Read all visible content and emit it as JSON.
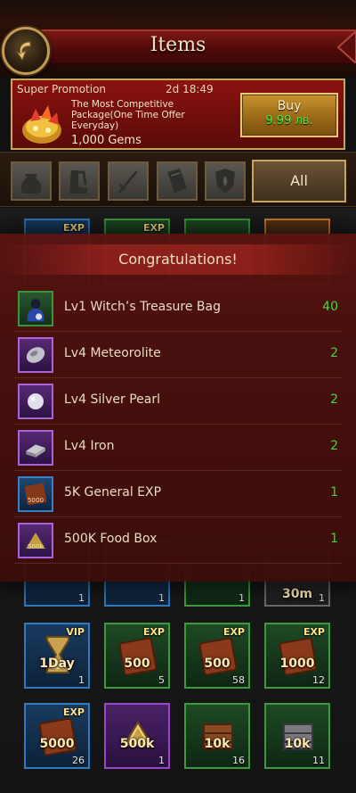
{
  "header": {
    "title": "Items"
  },
  "promotion": {
    "label": "Super Promotion",
    "timer": "2d 18:49",
    "description": "The Most Competitive Package(One Time Offer Everyday)",
    "gems": "1,000 Gems",
    "buy_label": "Buy",
    "price": "9.99 лв."
  },
  "tabs": {
    "icons": [
      "bag-icon",
      "boots-icon",
      "sword-icon",
      "book-icon",
      "shield-icon"
    ],
    "all_label": "All"
  },
  "congrats": {
    "title": "Congratulations!",
    "rewards": [
      {
        "name": "Lv1 Witch’s Treasure Bag",
        "qty": "40"
      },
      {
        "name": "Lv4 Meteorolite",
        "qty": "2"
      },
      {
        "name": "Lv4 Silver Pearl",
        "qty": "2"
      },
      {
        "name": "Lv4 Iron",
        "qty": "2"
      },
      {
        "name": "5K General EXP",
        "qty": "1"
      },
      {
        "name": "500K Food Box",
        "qty": "1"
      }
    ]
  },
  "grid": {
    "row_top": [
      {
        "tag": "EXP"
      },
      {
        "tag": "EXP"
      },
      {
        "tag": ""
      },
      {
        "tag": ""
      }
    ],
    "row_a": [
      {
        "big": "",
        "count": "1"
      },
      {
        "big": "",
        "count": "1"
      },
      {
        "big": "",
        "count": "1"
      },
      {
        "big": "30m",
        "count": "1"
      }
    ],
    "row_b": [
      {
        "tag": "VIP",
        "big": "1Day",
        "count": "1"
      },
      {
        "tag": "EXP",
        "big": "500",
        "count": "5"
      },
      {
        "tag": "EXP",
        "big": "500",
        "count": "58"
      },
      {
        "tag": "EXP",
        "big": "1000",
        "count": "12"
      }
    ],
    "row_c": [
      {
        "tag": "EXP",
        "big": "5000",
        "count": "26"
      },
      {
        "tag": "",
        "big": "500k",
        "count": "1"
      },
      {
        "tag": "",
        "big": "10k",
        "count": "16"
      },
      {
        "tag": "",
        "big": "10k",
        "count": "11"
      }
    ]
  }
}
